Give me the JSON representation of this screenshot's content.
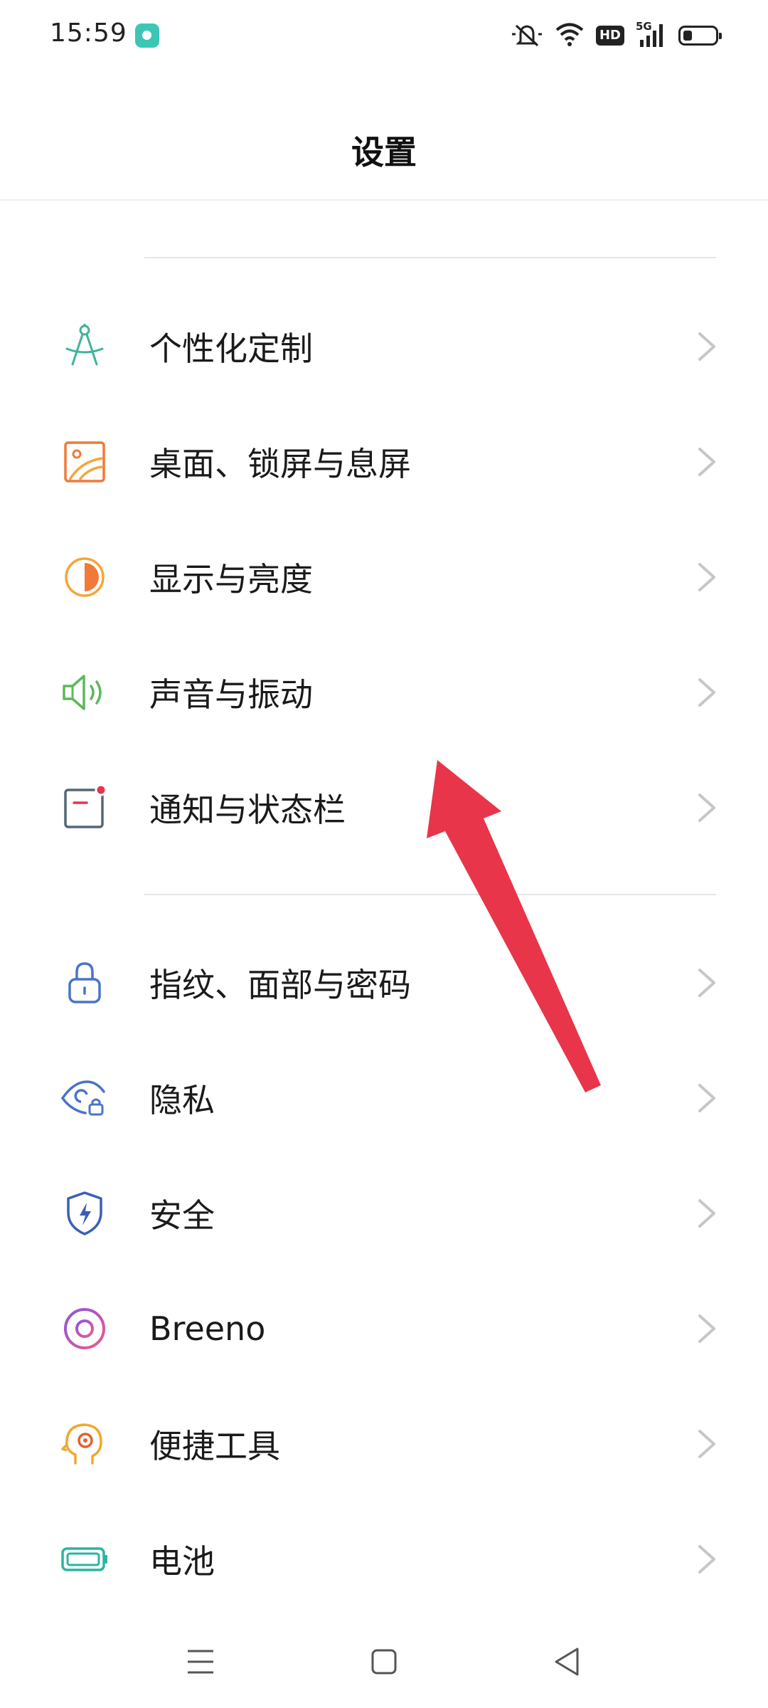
{
  "status": {
    "time": "15:59",
    "hd": "HD",
    "network": "5G"
  },
  "header": {
    "title": "设置"
  },
  "items": [
    {
      "label": "个性化定制",
      "icon": "compass-icon",
      "color": "#3fb39b"
    },
    {
      "label": "桌面、锁屏与息屏",
      "icon": "wallpaper-icon",
      "color": "#ef7a3a"
    },
    {
      "label": "显示与亮度",
      "icon": "brightness-icon",
      "color": "#f5a53a"
    },
    {
      "label": "声音与振动",
      "icon": "speaker-icon",
      "color": "#5cb85c"
    },
    {
      "label": "通知与状态栏",
      "icon": "notification-icon",
      "color": "#556677"
    },
    {
      "label": "指纹、面部与密码",
      "icon": "lock-icon",
      "color": "#4a73c9"
    },
    {
      "label": "隐私",
      "icon": "privacy-eye-icon",
      "color": "#4a73c9"
    },
    {
      "label": "安全",
      "icon": "shield-icon",
      "color": "#3a5fb8"
    },
    {
      "label": "Breeno",
      "icon": "breeno-icon",
      "color": "#c356c9"
    },
    {
      "label": "便捷工具",
      "icon": "tools-head-icon",
      "color": "#f0a830"
    },
    {
      "label": "电池",
      "icon": "battery-icon",
      "color": "#2cb5a0"
    }
  ],
  "annotation": {
    "arrow_color": "#e8354a"
  }
}
